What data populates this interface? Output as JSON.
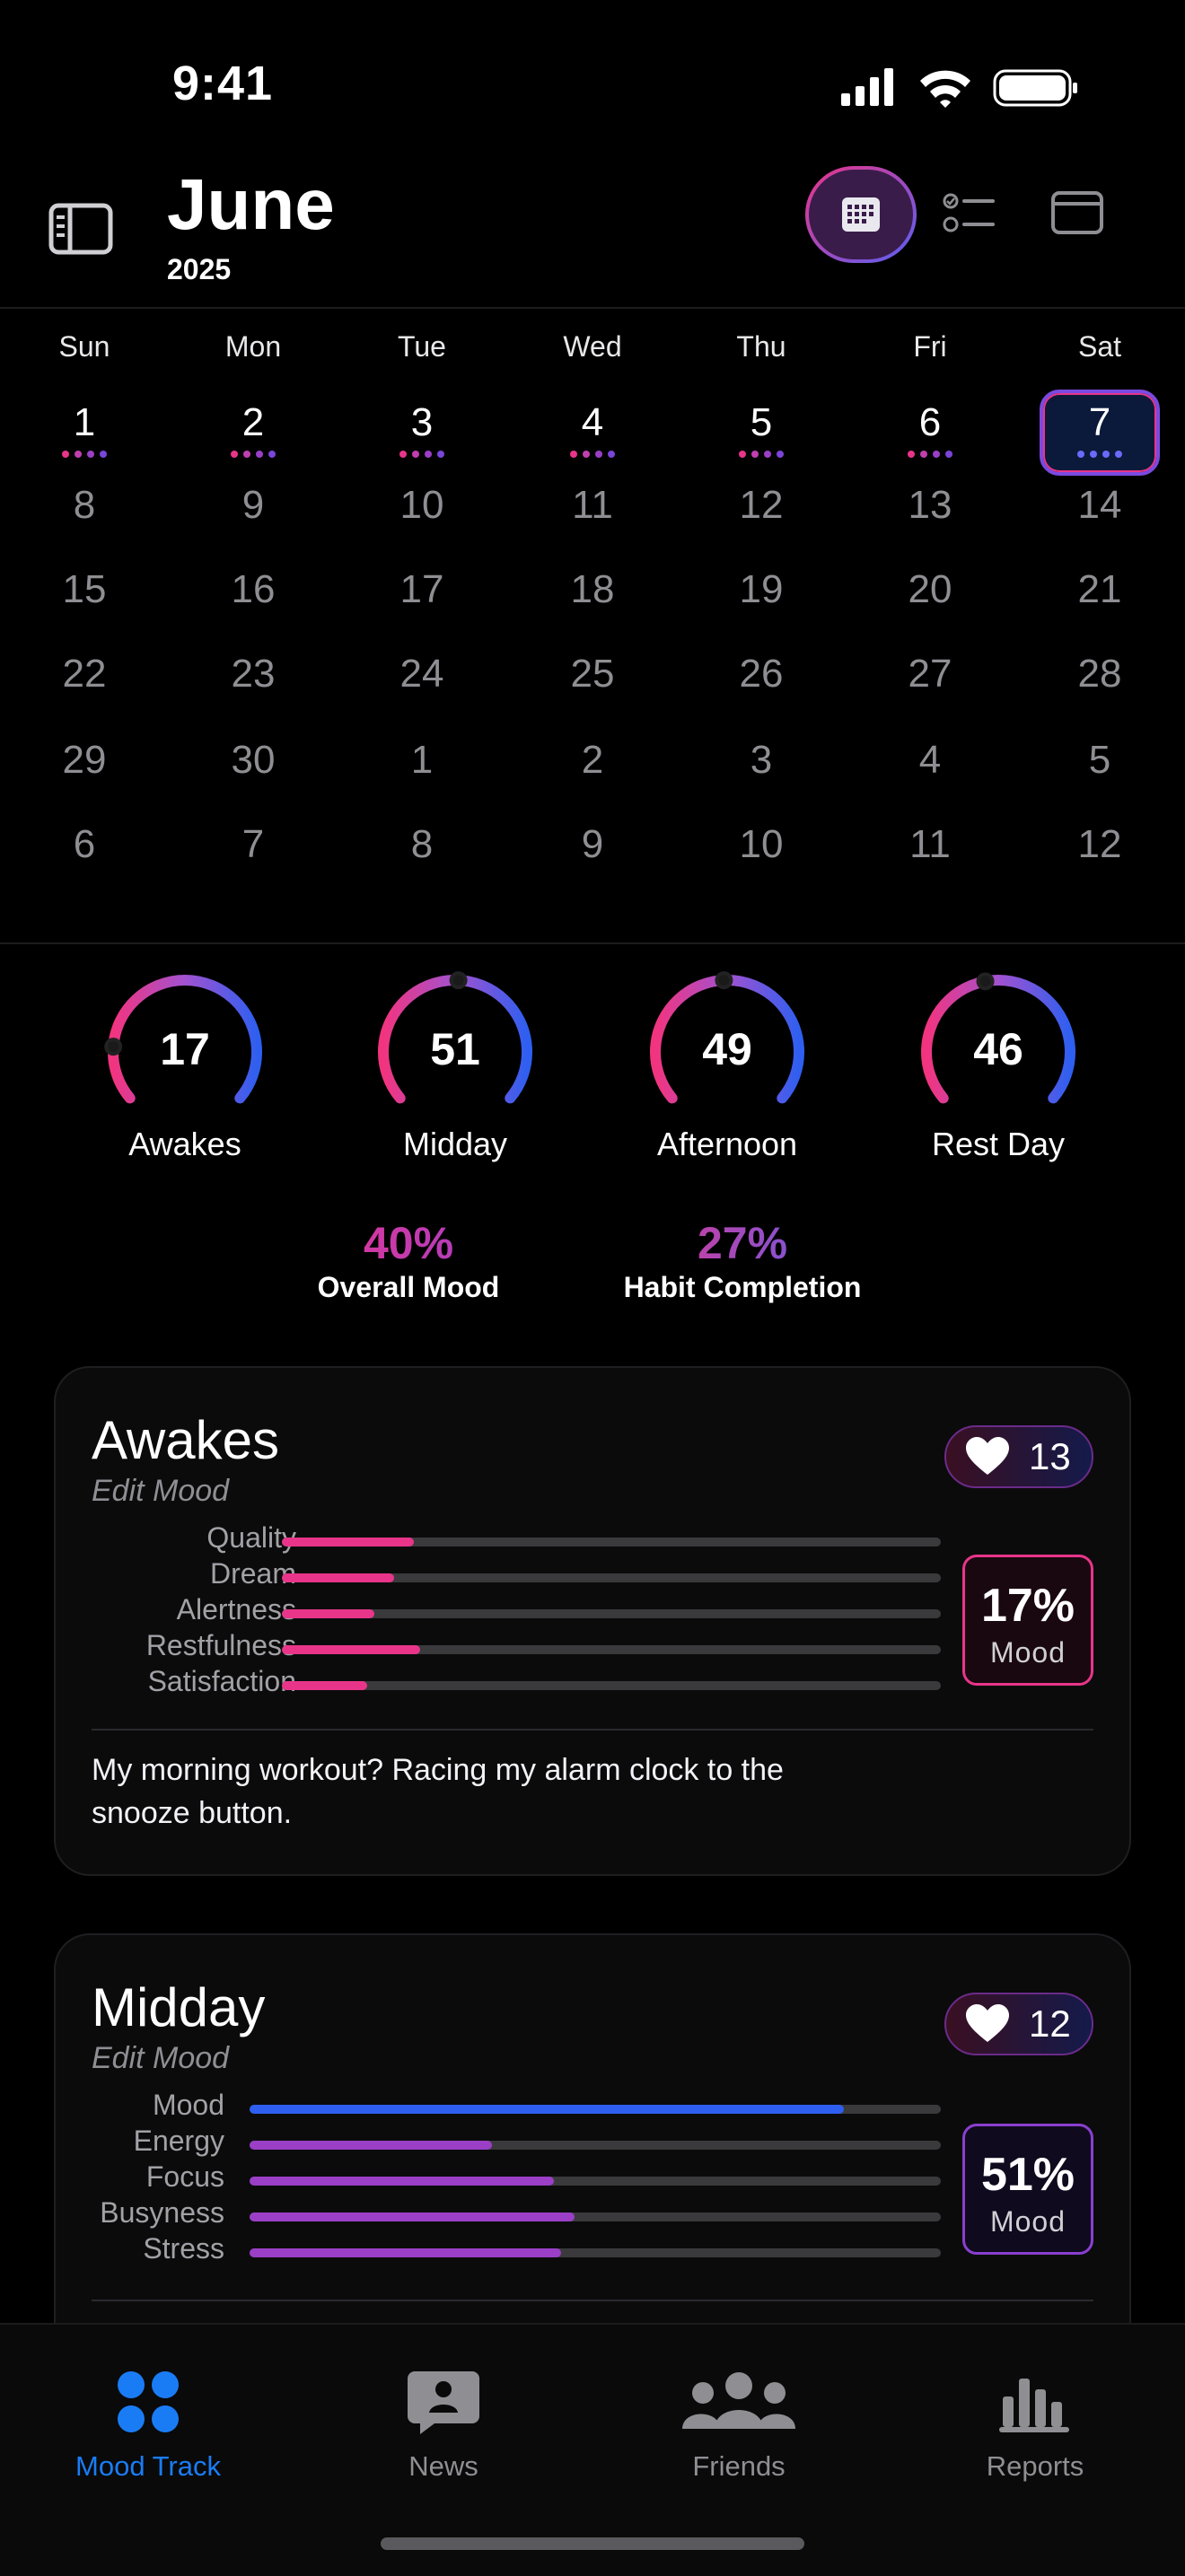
{
  "status": {
    "time": "9:41"
  },
  "header": {
    "month": "June",
    "year": "2025"
  },
  "weekdays": [
    "Sun",
    "Mon",
    "Tue",
    "Wed",
    "Thu",
    "Fri",
    "Sat"
  ],
  "calendar_rows": [
    [
      "1",
      "2",
      "3",
      "4",
      "5",
      "6",
      "7"
    ],
    [
      "8",
      "9",
      "10",
      "11",
      "12",
      "13",
      "14"
    ],
    [
      "15",
      "16",
      "17",
      "18",
      "19",
      "20",
      "21"
    ],
    [
      "22",
      "23",
      "24",
      "25",
      "26",
      "27",
      "28"
    ],
    [
      "29",
      "30",
      "1",
      "2",
      "3",
      "4",
      "5"
    ],
    [
      "6",
      "7",
      "8",
      "9",
      "10",
      "11",
      "12"
    ]
  ],
  "selected_day": "7",
  "rings": [
    {
      "value": "17",
      "label": "Awakes",
      "fraction": 0.17
    },
    {
      "value": "51",
      "label": "Midday",
      "fraction": 0.51
    },
    {
      "value": "49",
      "label": "Afternoon",
      "fraction": 0.49
    },
    {
      "value": "46",
      "label": "Rest Day",
      "fraction": 0.46
    }
  ],
  "summary": {
    "overall_mood_value": "40%",
    "overall_mood_label": "Overall Mood",
    "habit_value": "27%",
    "habit_label": "Habit Completion"
  },
  "cards": [
    {
      "title": "Awakes",
      "subtitle": "Edit Mood",
      "hearts": "13",
      "mood_value": "17%",
      "mood_label": "Mood",
      "metrics": [
        {
          "label": "Quality",
          "fraction": 0.2
        },
        {
          "label": "Dream",
          "fraction": 0.17
        },
        {
          "label": "Alertness",
          "fraction": 0.14
        },
        {
          "label": "Restfulness",
          "fraction": 0.21
        },
        {
          "label": "Satisfaction",
          "fraction": 0.13
        }
      ],
      "note_line1": "My morning workout? Racing my alarm clock to the",
      "note_line2": "snooze button."
    },
    {
      "title": "Midday",
      "subtitle": "Edit Mood",
      "hearts": "12",
      "mood_value": "51%",
      "mood_label": "Mood",
      "metrics": [
        {
          "label": "Mood",
          "fraction": 0.86
        },
        {
          "label": "Energy",
          "fraction": 0.35
        },
        {
          "label": "Focus",
          "fraction": 0.44
        },
        {
          "label": "Busyness",
          "fraction": 0.47
        },
        {
          "label": "Stress",
          "fraction": 0.45
        }
      ]
    }
  ],
  "tabs": [
    {
      "label": "Mood Track",
      "icon": "grid-dots-icon",
      "active": true
    },
    {
      "label": "News",
      "icon": "chat-bubble-person-icon",
      "active": false
    },
    {
      "label": "Friends",
      "icon": "people-group-icon",
      "active": false
    },
    {
      "label": "Reports",
      "icon": "bar-chart-icon",
      "active": false
    }
  ],
  "colors": {
    "accent_blue": "#1a7cf5",
    "pink": "#e8358a",
    "purple": "#9b3fc7",
    "blue_bar": "#2f5ff0"
  }
}
